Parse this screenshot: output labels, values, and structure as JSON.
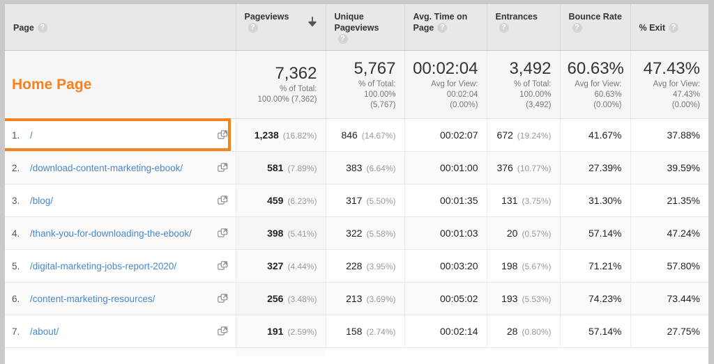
{
  "table": {
    "columns": [
      {
        "id": "page",
        "label": "Page",
        "help": "?",
        "sorted": false
      },
      {
        "id": "pv",
        "label": "Pageviews",
        "help": "?",
        "sorted": true,
        "sort_dir": "descending"
      },
      {
        "id": "upv",
        "label": "Unique Pageviews",
        "help": "?",
        "sorted": false
      },
      {
        "id": "avgt",
        "label": "Avg. Time on Page",
        "help": "?",
        "sorted": false
      },
      {
        "id": "entr",
        "label": "Entrances",
        "help": "?",
        "sorted": false
      },
      {
        "id": "bounce",
        "label": "Bounce Rate",
        "help": "?",
        "sorted": false
      },
      {
        "id": "exit",
        "label": "% Exit",
        "help": "?",
        "sorted": false
      }
    ],
    "summary": {
      "label": "Home Page",
      "pageviews": {
        "value": "7,362",
        "note1": "% of Total:",
        "note2": "100.00% (7,362)"
      },
      "unique_pageviews": {
        "value": "5,767",
        "note1": "% of Total:",
        "note2": "100.00%",
        "note3": "(5,767)"
      },
      "avg_time": {
        "value": "00:02:04",
        "note1": "Avg for View:",
        "note2": "00:02:04",
        "note3": "(0.00%)"
      },
      "entrances": {
        "value": "3,492",
        "note1": "% of Total:",
        "note2": "100.00%",
        "note3": "(3,492)"
      },
      "bounce_rate": {
        "value": "60.63%",
        "note1": "Avg for View:",
        "note2": "60.63%",
        "note3": "(0.00%)"
      },
      "exit_rate": {
        "value": "47.43%",
        "note1": "Avg for View:",
        "note2": "47.43%",
        "note3": "(0.00%)"
      }
    },
    "rows": [
      {
        "index": "1.",
        "path": "/",
        "highlighted": true,
        "pageviews": "1,238",
        "pageviews_pct": "(16.82%)",
        "unique_pageviews": "846",
        "unique_pageviews_pct": "(14.67%)",
        "avg_time": "00:02:07",
        "entrances": "672",
        "entrances_pct": "(19.24%)",
        "bounce_rate": "41.67%",
        "exit_rate": "37.88%"
      },
      {
        "index": "2.",
        "path": "/download-content-marketing-ebook/",
        "highlighted": false,
        "pageviews": "581",
        "pageviews_pct": "(7.89%)",
        "unique_pageviews": "383",
        "unique_pageviews_pct": "(6.64%)",
        "avg_time": "00:01:00",
        "entrances": "376",
        "entrances_pct": "(10.77%)",
        "bounce_rate": "27.39%",
        "exit_rate": "39.59%"
      },
      {
        "index": "3.",
        "path": "/blog/",
        "highlighted": false,
        "pageviews": "459",
        "pageviews_pct": "(6.23%)",
        "unique_pageviews": "317",
        "unique_pageviews_pct": "(5.50%)",
        "avg_time": "00:01:35",
        "entrances": "131",
        "entrances_pct": "(3.75%)",
        "bounce_rate": "31.30%",
        "exit_rate": "21.35%"
      },
      {
        "index": "4.",
        "path": "/thank-you-for-downloading-the-ebook/",
        "highlighted": false,
        "pageviews": "398",
        "pageviews_pct": "(5.41%)",
        "unique_pageviews": "322",
        "unique_pageviews_pct": "(5.58%)",
        "avg_time": "00:01:03",
        "entrances": "20",
        "entrances_pct": "(0.57%)",
        "bounce_rate": "57.14%",
        "exit_rate": "47.24%"
      },
      {
        "index": "5.",
        "path": "/digital-marketing-jobs-report-2020/",
        "highlighted": false,
        "pageviews": "327",
        "pageviews_pct": "(4.44%)",
        "unique_pageviews": "228",
        "unique_pageviews_pct": "(3.95%)",
        "avg_time": "00:03:20",
        "entrances": "198",
        "entrances_pct": "(5.67%)",
        "bounce_rate": "71.21%",
        "exit_rate": "57.80%"
      },
      {
        "index": "6.",
        "path": "/content-marketing-resources/",
        "highlighted": false,
        "pageviews": "256",
        "pageviews_pct": "(3.48%)",
        "unique_pageviews": "213",
        "unique_pageviews_pct": "(3.69%)",
        "avg_time": "00:05:02",
        "entrances": "193",
        "entrances_pct": "(5.53%)",
        "bounce_rate": "74.23%",
        "exit_rate": "73.44%"
      },
      {
        "index": "7.",
        "path": "/about/",
        "highlighted": false,
        "pageviews": "191",
        "pageviews_pct": "(2.59%)",
        "unique_pageviews": "158",
        "unique_pageviews_pct": "(2.74%)",
        "avg_time": "00:02:14",
        "entrances": "28",
        "entrances_pct": "(0.80%)",
        "bounce_rate": "57.14%",
        "exit_rate": "27.75%"
      }
    ]
  },
  "icons": {
    "external_link": "open-in-new-window-icon",
    "help": "help-icon",
    "sort_descending": "sort-arrow-down-icon"
  },
  "colors": {
    "accent": "#f5821f",
    "link": "#4a87c9",
    "header_bg": "#e8e8e8",
    "muted_text": "#9a9a9a"
  }
}
